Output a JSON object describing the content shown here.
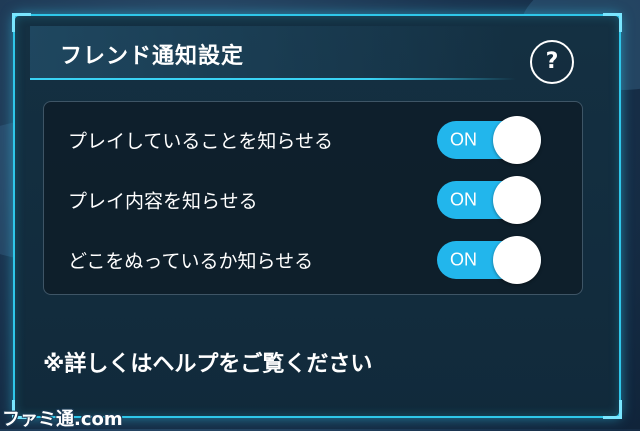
{
  "title": "フレンド通知設定",
  "help_button": {
    "label": "?"
  },
  "settings": [
    {
      "label": "プレイしていることを知らせる",
      "state": "ON"
    },
    {
      "label": "プレイ内容を知らせる",
      "state": "ON"
    },
    {
      "label": "どこをぬっているか知らせる",
      "state": "ON"
    }
  ],
  "footer_note": "※詳しくはヘルプをご覧ください",
  "watermark": "ファミ通.com",
  "colors": {
    "accent": "#22b6ec",
    "border": "#2fc7ea",
    "panel": "#143042"
  }
}
